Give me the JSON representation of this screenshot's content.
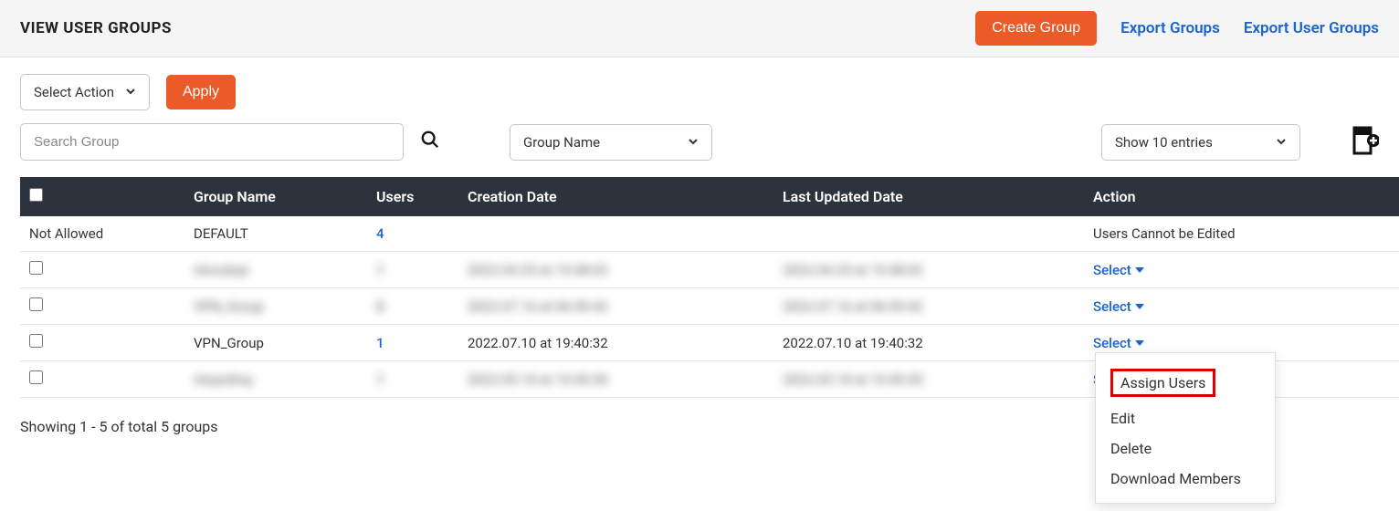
{
  "header": {
    "title": "VIEW USER GROUPS",
    "create_btn": "Create Group",
    "export_groups": "Export Groups",
    "export_user_groups": "Export User Groups"
  },
  "toolbar": {
    "select_action": "Select Action",
    "apply": "Apply"
  },
  "filter": {
    "search_placeholder": "Search Group",
    "groupname_select": "Group Name",
    "entries_select": "Show 10 entries"
  },
  "table": {
    "headers": {
      "name": "Group Name",
      "users": "Users",
      "cdate": "Creation Date",
      "udate": "Last Updated Date",
      "action": "Action"
    },
    "rows": [
      {
        "chk_label": "Not Allowed",
        "name": "DEFAULT",
        "users": "4",
        "cdate": "",
        "udate": "",
        "action_text": "Users Cannot be Edited",
        "action_is_select": false,
        "has_checkbox": false,
        "blurred": false
      },
      {
        "chk_label": "",
        "name": "nlsvulnpt",
        "users": "1",
        "cdate": "2022.04.25 at 19:48:02",
        "udate": "2022.04.25 at 19:48:02",
        "action_text": "Select",
        "action_is_select": true,
        "has_checkbox": true,
        "blurred": true
      },
      {
        "chk_label": "",
        "name": "VPN_Group",
        "users": "0",
        "cdate": "2022.07.16 at 06:59:42",
        "udate": "2022.07.16 at 06:59:42",
        "action_text": "Select",
        "action_is_select": true,
        "has_checkbox": true,
        "blurred": true
      },
      {
        "chk_label": "",
        "name": "VPN_Group",
        "users": "1",
        "cdate": "2022.07.10 at 19:40:32",
        "udate": "2022.07.10 at 19:40:32",
        "action_text": "Select",
        "action_is_select": true,
        "has_checkbox": true,
        "blurred": false,
        "dropdown_open": true
      },
      {
        "chk_label": "",
        "name": "ntoprdmp",
        "users": "1",
        "cdate": "2022.05.18 at 10:45:30",
        "udate": "2022.05.18 at 10:45:30",
        "action_text": "Select",
        "action_is_select": true,
        "has_checkbox": true,
        "blurred": true
      }
    ]
  },
  "dropdown": {
    "assign": "Assign Users",
    "edit": "Edit",
    "delete": "Delete",
    "download": "Download Members"
  },
  "footer": {
    "summary": "Showing 1 - 5 of total 5 groups"
  }
}
